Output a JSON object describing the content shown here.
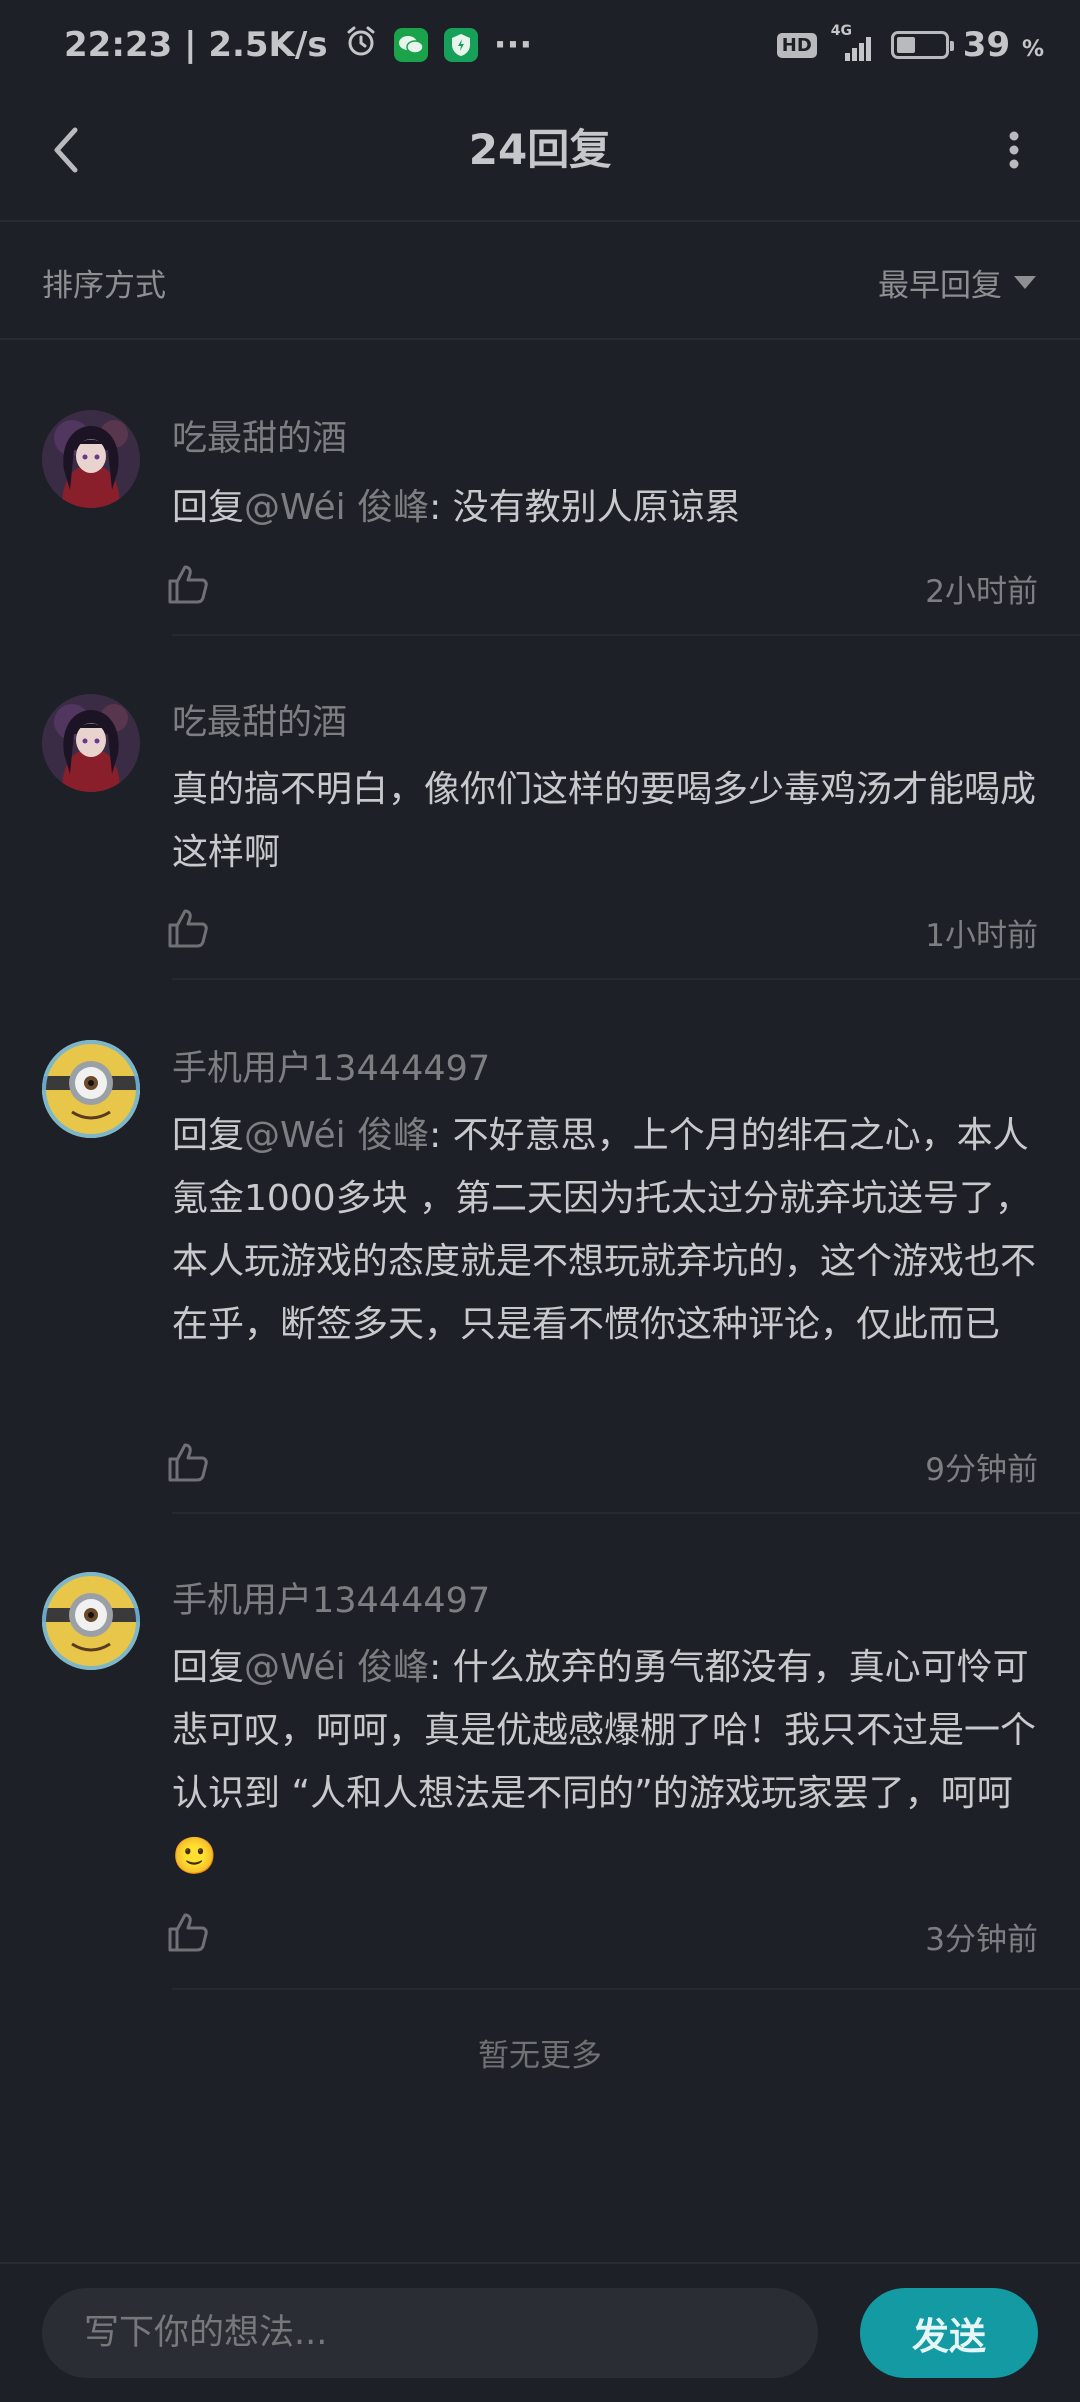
{
  "status_bar": {
    "time_speed": "22:23 | 2.5K/s",
    "more_dots": "···",
    "hd": "HD",
    "network": "4G",
    "battery_percent": "39",
    "percent_sign": "%",
    "battery_level": 0.39
  },
  "header": {
    "title": "24回复"
  },
  "sort": {
    "label": "排序方式",
    "selected": "最早回复"
  },
  "comments": [
    {
      "user": "吃最甜的酒",
      "prefix": "回复",
      "mention": "@Wéi 俊峰",
      "text": ": 没有教别人原谅累",
      "time": "2小时前",
      "avatar": "anime-girl-avatar"
    },
    {
      "user": "吃最甜的酒",
      "prefix": "",
      "mention": "",
      "text": "真的搞不明白，像你们这样的要喝多少毒鸡汤才能喝成这样啊",
      "time": "1小时前",
      "avatar": "anime-girl-avatar"
    },
    {
      "user": "手机用户13444497",
      "prefix": "回复",
      "mention": "@Wéi 俊峰",
      "text": ": 不好意思，上个月的绯石之心，本人氪金1000多块 ，第二天因为托太过分就弃坑送号了，本人玩游戏的态度就是不想玩就弃坑的，这个游戏也不在乎，断签多天，只是看不惯你这种评论，仅此而已",
      "time": "9分钟前",
      "avatar": "minion-avatar"
    },
    {
      "user": "手机用户13444497",
      "prefix": "回复",
      "mention": "@Wéi 俊峰",
      "text": ": 什么放弃的勇气都没有，真心可怜可悲可叹，呵呵，真是优越感爆棚了哈！我只不过是一个认识到 “人和人想法是不同的”的游戏玩家罢了，呵呵🙂",
      "time": "3分钟前",
      "avatar": "minion-avatar"
    }
  ],
  "footer": {
    "no_more": "暂无更多"
  },
  "input": {
    "placeholder": "写下你的想法...",
    "value": "",
    "send_label": "发送"
  },
  "colors": {
    "background": "#1e2027",
    "accent": "#139aa3",
    "secondary_text": "#7c7e82",
    "primary_text": "#c8c9cc"
  }
}
